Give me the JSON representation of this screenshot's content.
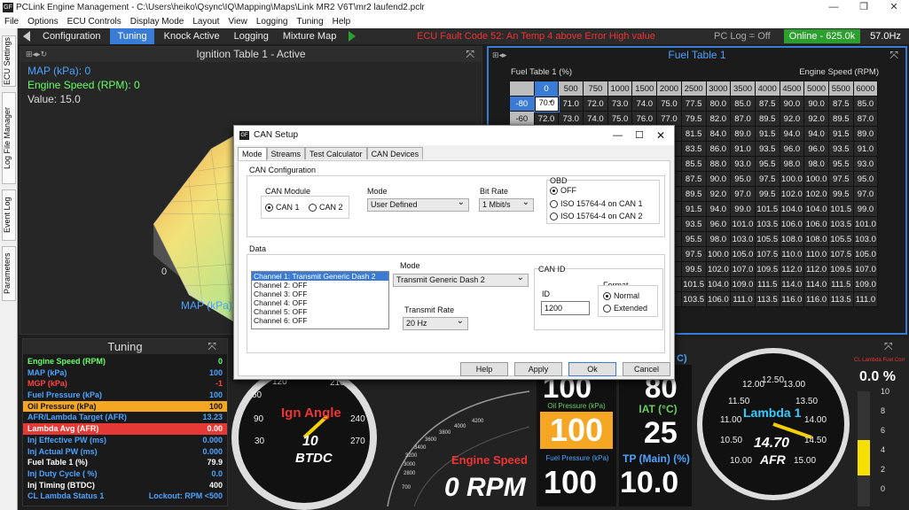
{
  "window": {
    "title": "PCLink Engine Management - C:\\Users\\heiko\\Qsync\\IQ\\Mapping\\Maps\\Link MR2 V6T\\mr2 laufend2.pclr",
    "logo": "GF"
  },
  "menu": [
    "File",
    "Options",
    "ECU Controls",
    "Display Mode",
    "Layout",
    "View",
    "Logging",
    "Tuning",
    "Help"
  ],
  "side_tabs": [
    "ECU Settings",
    "Log File Manager",
    "Event Log",
    "Parameters"
  ],
  "nav": {
    "tabs": [
      "Configuration",
      "Tuning",
      "Knock Active",
      "Logging",
      "Mixture Map"
    ],
    "active": "Tuning",
    "fault": "ECU Fault Code 52: An Temp 4 above Error High value",
    "pc_log": "PC Log = Off",
    "online": "Online - 625.0k",
    "rate": "57.0Hz"
  },
  "ign": {
    "title": "Ignition Table 1 - Active",
    "map": "MAP (kPa): 0",
    "rpm": "Engine Speed (RPM): 0",
    "value": "Value: 15.0",
    "axis0": "0",
    "axis_map": "MAP (kPa)"
  },
  "fuel": {
    "title": "Fuel Table 1",
    "row_title": "Fuel Table 1 (%)",
    "col_title": "Engine Speed (RPM)",
    "cols": [
      "0",
      "500",
      "750",
      "1000",
      "1500",
      "2000",
      "2500",
      "3000",
      "3500",
      "4000",
      "4500",
      "5000",
      "5500",
      "6000"
    ],
    "rows": [
      {
        "k": "-80",
        "v": [
          "70.0",
          "71.0",
          "72.0",
          "73.0",
          "74.0",
          "75.0",
          "77.5",
          "80.0",
          "85.0",
          "87.5",
          "90.0",
          "90.0",
          "87.5",
          "85.0"
        ]
      },
      {
        "k": "-60",
        "v": [
          "72.0",
          "73.0",
          "74.0",
          "75.0",
          "76.0",
          "77.0",
          "79.5",
          "82.0",
          "87.0",
          "89.5",
          "92.0",
          "92.0",
          "89.5",
          "87.0"
        ]
      },
      {
        "k": "",
        "v": [
          "",
          "",
          "",
          "",
          "",
          "",
          "81.5",
          "84.0",
          "89.0",
          "91.5",
          "94.0",
          "94.0",
          "91.5",
          "89.0"
        ]
      },
      {
        "k": "",
        "v": [
          "",
          "",
          "",
          "",
          "",
          "",
          "83.5",
          "86.0",
          "91.0",
          "93.5",
          "96.0",
          "96.0",
          "93.5",
          "91.0"
        ]
      },
      {
        "k": "",
        "v": [
          "",
          "",
          "",
          "",
          "",
          "",
          "85.5",
          "88.0",
          "93.0",
          "95.5",
          "98.0",
          "98.0",
          "95.5",
          "93.0"
        ]
      },
      {
        "k": "",
        "v": [
          "",
          "",
          "",
          "",
          "",
          "",
          "87.5",
          "90.0",
          "95.0",
          "97.5",
          "100.0",
          "100.0",
          "97.5",
          "95.0"
        ]
      },
      {
        "k": "",
        "v": [
          "",
          "",
          "",
          "",
          "",
          "",
          "89.5",
          "92.0",
          "97.0",
          "99.5",
          "102.0",
          "102.0",
          "99.5",
          "97.0"
        ]
      },
      {
        "k": "",
        "v": [
          "",
          "",
          "",
          "",
          "",
          "",
          "91.5",
          "94.0",
          "99.0",
          "101.5",
          "104.0",
          "104.0",
          "101.5",
          "99.0"
        ]
      },
      {
        "k": "",
        "v": [
          "",
          "",
          "",
          "",
          "",
          "",
          "93.5",
          "96.0",
          "101.0",
          "103.5",
          "106.0",
          "106.0",
          "103.5",
          "101.0"
        ]
      },
      {
        "k": "",
        "v": [
          "",
          "",
          "",
          "",
          "",
          "",
          "95.5",
          "98.0",
          "103.0",
          "105.5",
          "108.0",
          "108.0",
          "105.5",
          "103.0"
        ]
      },
      {
        "k": "",
        "v": [
          "",
          "",
          "",
          "",
          "",
          "",
          "97.5",
          "100.0",
          "105.0",
          "107.5",
          "110.0",
          "110.0",
          "107.5",
          "105.0"
        ]
      },
      {
        "k": "",
        "v": [
          "",
          "",
          "",
          "",
          "",
          "",
          "99.5",
          "102.0",
          "107.0",
          "109.5",
          "112.0",
          "112.0",
          "109.5",
          "107.0"
        ]
      },
      {
        "k": "",
        "v": [
          "",
          "",
          "",
          "",
          "",
          "",
          "101.5",
          "104.0",
          "109.0",
          "111.5",
          "114.0",
          "114.0",
          "111.5",
          "109.0"
        ]
      },
      {
        "k": "",
        "v": [
          "",
          "",
          "",
          "",
          "",
          "",
          "103.5",
          "106.0",
          "111.0",
          "113.5",
          "116.0",
          "116.0",
          "113.5",
          "111.0"
        ]
      }
    ]
  },
  "tuning": {
    "title": "Tuning",
    "rows": [
      {
        "n": "Engine Speed (RPM)",
        "v": "0",
        "c": "#6f6"
      },
      {
        "n": "MAP (kPa)",
        "v": "100",
        "c": "#4aa3ff"
      },
      {
        "n": "MGP (kPa)",
        "v": "-1",
        "c": "#f44"
      },
      {
        "n": "Fuel Pressure (kPa)",
        "v": "100",
        "c": "#4aa3ff"
      },
      {
        "n": "Oil Pressure (kPa)",
        "v": "100",
        "c": "#111",
        "bg": "#f5a623"
      },
      {
        "n": "AFR/Lambda Target (AFR)",
        "v": "13.23",
        "c": "#4aa3ff"
      },
      {
        "n": "Lambda Avg (AFR)",
        "v": "0.00",
        "c": "#fff",
        "bg": "#e53935"
      },
      {
        "n": "Inj Effective PW (ms)",
        "v": "0.000",
        "c": "#4aa3ff"
      },
      {
        "n": "Inj Actual PW (ms)",
        "v": "0.000",
        "c": "#4aa3ff"
      },
      {
        "n": "Fuel Table 1 (%)",
        "v": "79.9",
        "c": "#fff"
      },
      {
        "n": "Inj Duty Cycle ( %)",
        "v": "0.0",
        "c": "#4aa3ff"
      },
      {
        "n": "Inj Timing (BTDC)",
        "v": "400",
        "c": "#fff"
      },
      {
        "n": "CL Lambda Status 1",
        "v": "Lockout: RPM <500",
        "c": "#4aa3ff"
      }
    ]
  },
  "gauges": {
    "ign_label": "Ign Angle",
    "ign_value": "10",
    "ign_unit": "BTDC",
    "ign_ticks": [
      "60",
      "90",
      "120",
      "210",
      "240",
      "270",
      "30"
    ],
    "eng_label": "Engine Speed",
    "eng_value": "0 RPM",
    "eng_ticks": [
      "4200",
      "4000",
      "3800",
      "3600",
      "3400",
      "3200",
      "3000",
      "2800",
      "700"
    ],
    "oil_label": "Oil Pressure (kPa)",
    "oil_value": "100",
    "fuel_label": "Fuel Pressure (kPa)",
    "fuel_value": "100",
    "top_value": "100",
    "top_value2": "80",
    "top_label_tail": "C)",
    "iat_label": "IAT (°C)",
    "iat_value": "25",
    "tp_label": "TP (Main) (%)",
    "tp_value": "10.0",
    "lambda_label": "Lambda 1",
    "lambda_value": "14.70",
    "lambda_unit": "AFR",
    "lambda_ticks": [
      "12.00",
      "12.50",
      "13.00",
      "11.50",
      "13.50",
      "11.00",
      "14.00",
      "10.50",
      "14.50",
      "10.00",
      "15.00"
    ],
    "cl_label": "CL Lambda Fuel Corr",
    "cl_value": "0.0 %",
    "bar_ticks": [
      "10",
      "8",
      "6",
      "4",
      "2",
      "0"
    ]
  },
  "dialog": {
    "title": "CAN Setup",
    "tabs": [
      "Mode",
      "Streams",
      "Test Calculator",
      "CAN Devices"
    ],
    "can_config": "CAN Configuration",
    "can_module": "CAN Module",
    "can1": "CAN 1",
    "can2": "CAN 2",
    "mode_label": "Mode",
    "mode_value": "User Defined",
    "bitrate_label": "Bit Rate",
    "bitrate_value": "1 Mbit/s",
    "obd_label": "OBD",
    "obd_off": "OFF",
    "obd_can1": "ISO 15764-4 on CAN 1",
    "obd_can2": "ISO 15764-4 on CAN 2",
    "data_label": "Data",
    "channels": [
      "Channel 1: Transmit Generic Dash 2",
      "Channel 2: OFF",
      "Channel 3: OFF",
      "Channel 4: OFF",
      "Channel 5: OFF",
      "Channel 6: OFF"
    ],
    "ch_mode_label": "Mode",
    "ch_mode_value": "Transmit Generic Dash 2",
    "rate_label": "Transmit Rate",
    "rate_value": "20 Hz",
    "canid_label": "CAN ID",
    "id_label": "ID",
    "id_value": "1200",
    "format_label": "Format",
    "fmt_normal": "Normal",
    "fmt_extended": "Extended",
    "buttons": [
      "Help",
      "Apply",
      "Ok",
      "Cancel"
    ]
  },
  "colors": {
    "accent": "#3a7bd5",
    "online": "#2ca02c",
    "fault": "#e33333"
  }
}
